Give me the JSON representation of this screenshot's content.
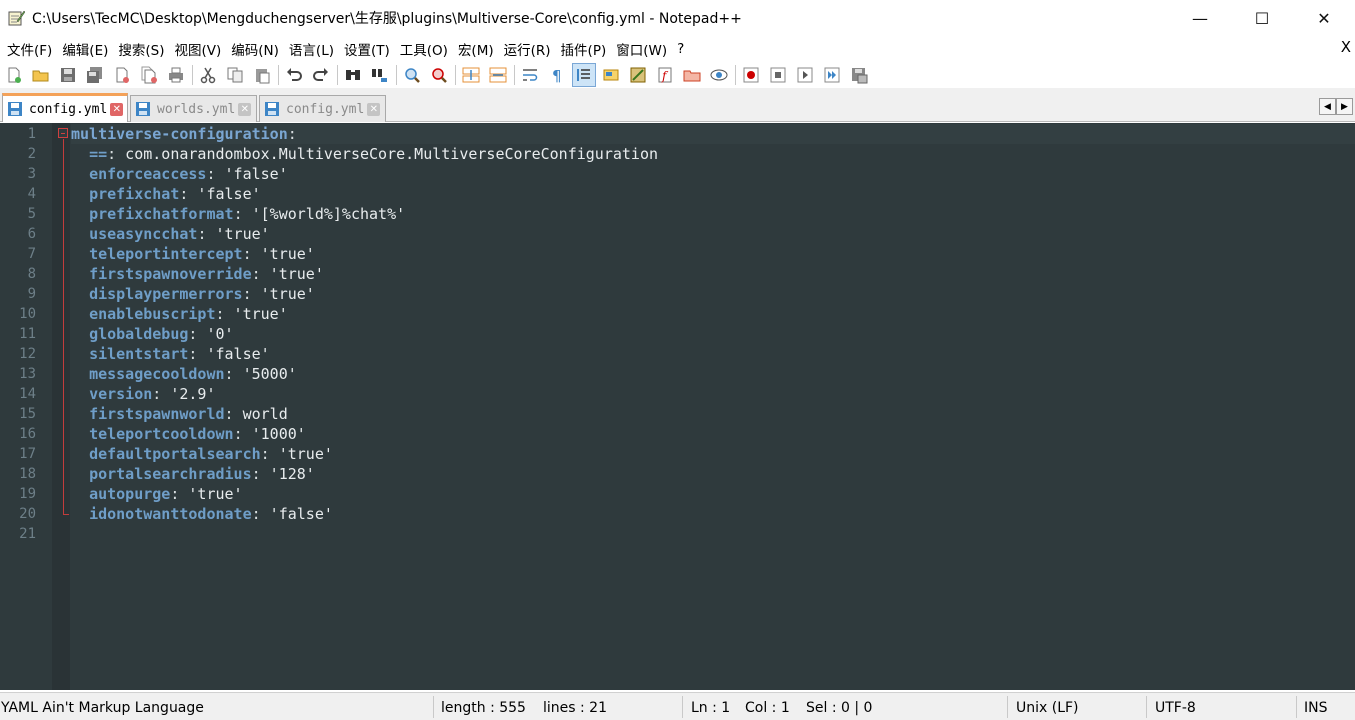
{
  "window": {
    "title": "C:\\Users\\TecMC\\Desktop\\Mengduchengserver\\生存服\\plugins\\Multiverse-Core\\config.yml - Notepad++",
    "minimize": "—",
    "maximize": "☐",
    "close": "✕"
  },
  "menu": {
    "items": [
      "文件(F)",
      "编辑(E)",
      "搜索(S)",
      "视图(V)",
      "编码(N)",
      "语言(L)",
      "设置(T)",
      "工具(O)",
      "宏(M)",
      "运行(R)",
      "插件(P)",
      "窗口(W)",
      "?"
    ],
    "close_doc": "X"
  },
  "tabs": [
    {
      "label": "config.yml",
      "active": true
    },
    {
      "label": "worlds.yml",
      "active": false
    },
    {
      "label": "config.yml",
      "active": false
    }
  ],
  "tab_scroll": {
    "left": "◀",
    "right": "▶"
  },
  "editor": {
    "line_numbers": [
      "1",
      "2",
      "3",
      "4",
      "5",
      "6",
      "7",
      "8",
      "9",
      "10",
      "11",
      "12",
      "13",
      "14",
      "15",
      "16",
      "17",
      "18",
      "19",
      "20",
      "21"
    ],
    "lines": [
      {
        "key": "multiverse-configuration",
        "sep": ":",
        "value": ""
      },
      {
        "key": "==",
        "sep": ":",
        "value": " com.onarandombox.MultiverseCore.MultiverseCoreConfiguration"
      },
      {
        "key": "enforceaccess",
        "sep": ":",
        "value": " 'false'"
      },
      {
        "key": "prefixchat",
        "sep": ":",
        "value": " 'false'"
      },
      {
        "key": "prefixchatformat",
        "sep": ":",
        "value": " '[%world%]%chat%'"
      },
      {
        "key": "useasyncchat",
        "sep": ":",
        "value": " 'true'"
      },
      {
        "key": "teleportintercept",
        "sep": ":",
        "value": " 'true'"
      },
      {
        "key": "firstspawnoverride",
        "sep": ":",
        "value": " 'true'"
      },
      {
        "key": "displaypermerrors",
        "sep": ":",
        "value": " 'true'"
      },
      {
        "key": "enablebuscript",
        "sep": ":",
        "value": " 'true'"
      },
      {
        "key": "globaldebug",
        "sep": ":",
        "value": " '0'"
      },
      {
        "key": "silentstart",
        "sep": ":",
        "value": " 'false'"
      },
      {
        "key": "messagecooldown",
        "sep": ":",
        "value": " '5000'"
      },
      {
        "key": "version",
        "sep": ":",
        "value": " '2.9'"
      },
      {
        "key": "firstspawnworld",
        "sep": ":",
        "value": " world"
      },
      {
        "key": "teleportcooldown",
        "sep": ":",
        "value": " '1000'"
      },
      {
        "key": "defaultportalsearch",
        "sep": ":",
        "value": " 'true'"
      },
      {
        "key": "portalsearchradius",
        "sep": ":",
        "value": " '128'"
      },
      {
        "key": "autopurge",
        "sep": ":",
        "value": " 'true'"
      },
      {
        "key": "idonotwanttodonate",
        "sep": ":",
        "value": " 'false'"
      },
      {
        "key": "",
        "sep": "",
        "value": ""
      }
    ]
  },
  "status": {
    "language": "YAML Ain't Markup Language",
    "length": "length : 555",
    "lines": "lines : 21",
    "ln": "Ln : 1",
    "col": "Col : 1",
    "sel": "Sel : 0 | 0",
    "eol": "Unix (LF)",
    "encoding": "UTF-8",
    "mode": "INS"
  },
  "colors": {
    "editor_bg": "#2f3a3d",
    "key": "#6f9ec8",
    "fold_guide": "#c23c3c",
    "active_tab_accent": "#f4a259"
  }
}
